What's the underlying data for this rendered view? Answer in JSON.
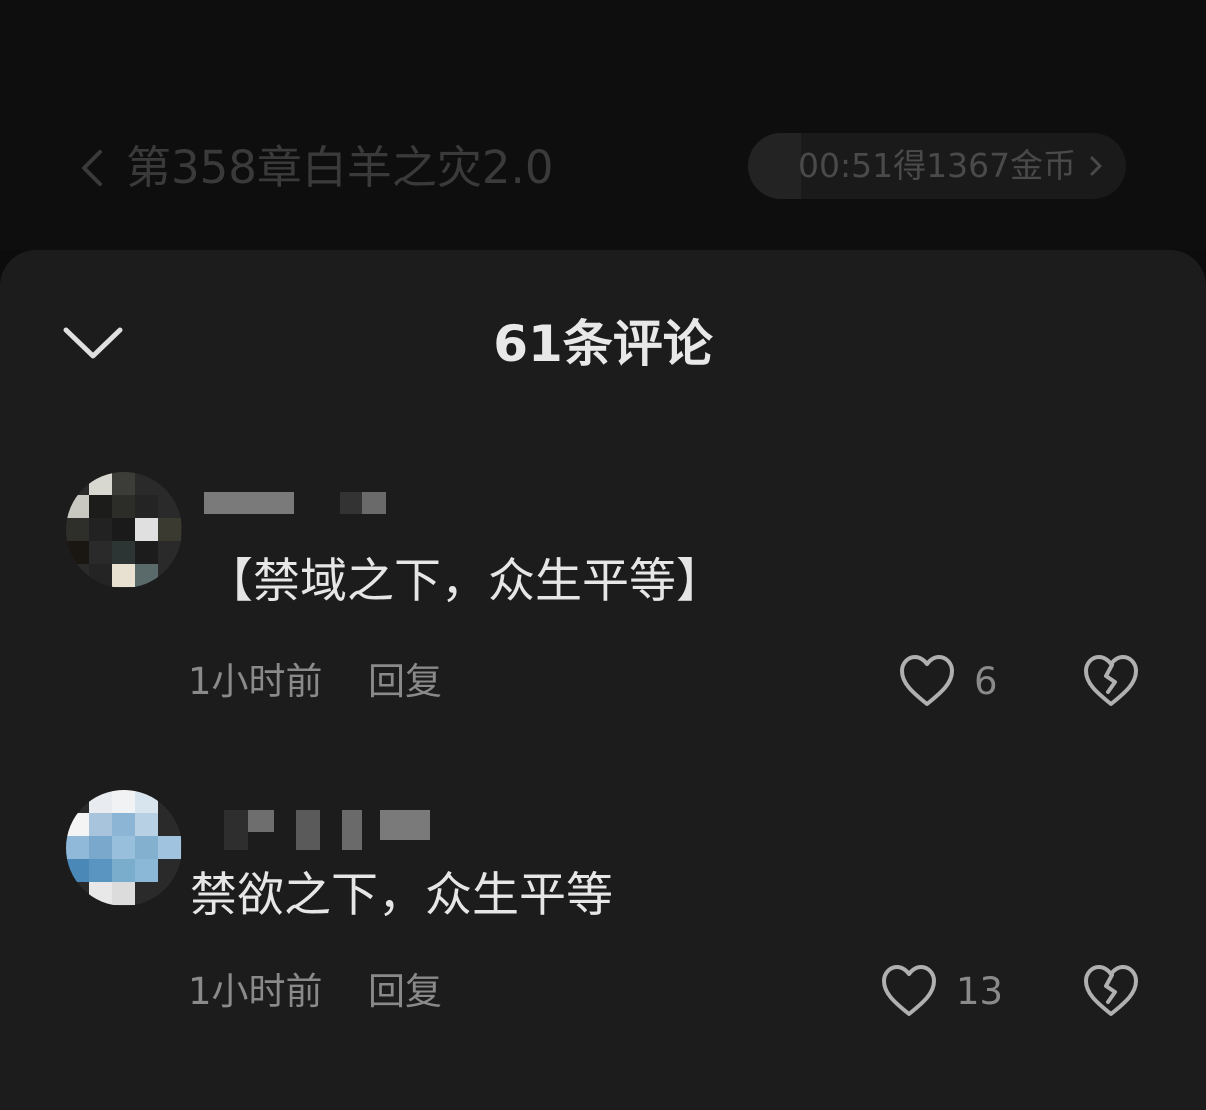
{
  "reader": {
    "chapter_title": "第358章白羊之灾2.0",
    "reward_text": "00:51得1367金币",
    "reward_progress": 0.14
  },
  "comments_sheet": {
    "title": "61条评论",
    "comments": [
      {
        "text": "【禁域之下，众生平等】",
        "time": "1小时前",
        "reply_label": "回复",
        "likes": "6"
      },
      {
        "text": "禁欲之下，众生平等",
        "time": "1小时前",
        "reply_label": "回复",
        "likes": "13"
      }
    ]
  },
  "icons": {
    "back": "chevron-left-icon",
    "reward_arrow": "chevron-right-icon",
    "collapse": "chevron-down-icon",
    "like": "heart-outline-icon",
    "dislike": "broken-heart-icon"
  },
  "colors": {
    "background": "#0c0c0c",
    "sheet": "#1c1c1c",
    "primary_text": "#e6e6e6",
    "secondary_text": "#8a8a8a",
    "dim_header_text": "#3a3a3a"
  }
}
